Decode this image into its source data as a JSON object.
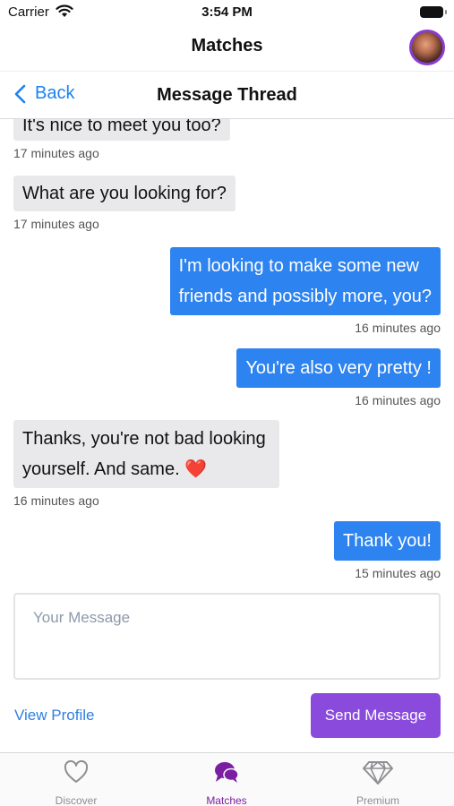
{
  "status_bar": {
    "carrier": "Carrier",
    "time": "3:54 PM"
  },
  "header": {
    "title": "Matches"
  },
  "nav": {
    "back_label": "Back",
    "title": "Message Thread"
  },
  "messages": [
    {
      "direction": "in",
      "lines": [
        "It's nice to meet you too?"
      ],
      "time": "17 minutes ago"
    },
    {
      "direction": "in",
      "lines": [
        "What are you looking for?"
      ],
      "time": "17 minutes ago"
    },
    {
      "direction": "out",
      "lines": [
        "I'm looking to make some new",
        "friends and possibly more, you?"
      ],
      "time": "16 minutes ago"
    },
    {
      "direction": "out",
      "lines": [
        "You're also very pretty !"
      ],
      "time": "16 minutes ago"
    },
    {
      "direction": "in",
      "lines": [
        "Thanks, you're not bad looking",
        "yourself. And same."
      ],
      "emoji": "❤️",
      "time": "16 minutes ago"
    },
    {
      "direction": "out",
      "lines": [
        "Thank you!"
      ],
      "time": "15 minutes ago"
    }
  ],
  "composer": {
    "placeholder": "Your Message",
    "value": ""
  },
  "actions": {
    "view_profile": "View Profile",
    "send": "Send Message"
  },
  "tabs": [
    {
      "label": "Discover",
      "icon": "heart-outline-icon",
      "active": false
    },
    {
      "label": "Matches",
      "icon": "chat-bubbles-icon",
      "active": true
    },
    {
      "label": "Premium",
      "icon": "diamond-icon",
      "active": false
    }
  ],
  "colors": {
    "accent": "#8a4bdd",
    "active_tab": "#7a1fa2",
    "outgoing_bubble": "#2d83ef",
    "incoming_bubble": "#e9e9eb",
    "link": "#2f7fe0"
  }
}
